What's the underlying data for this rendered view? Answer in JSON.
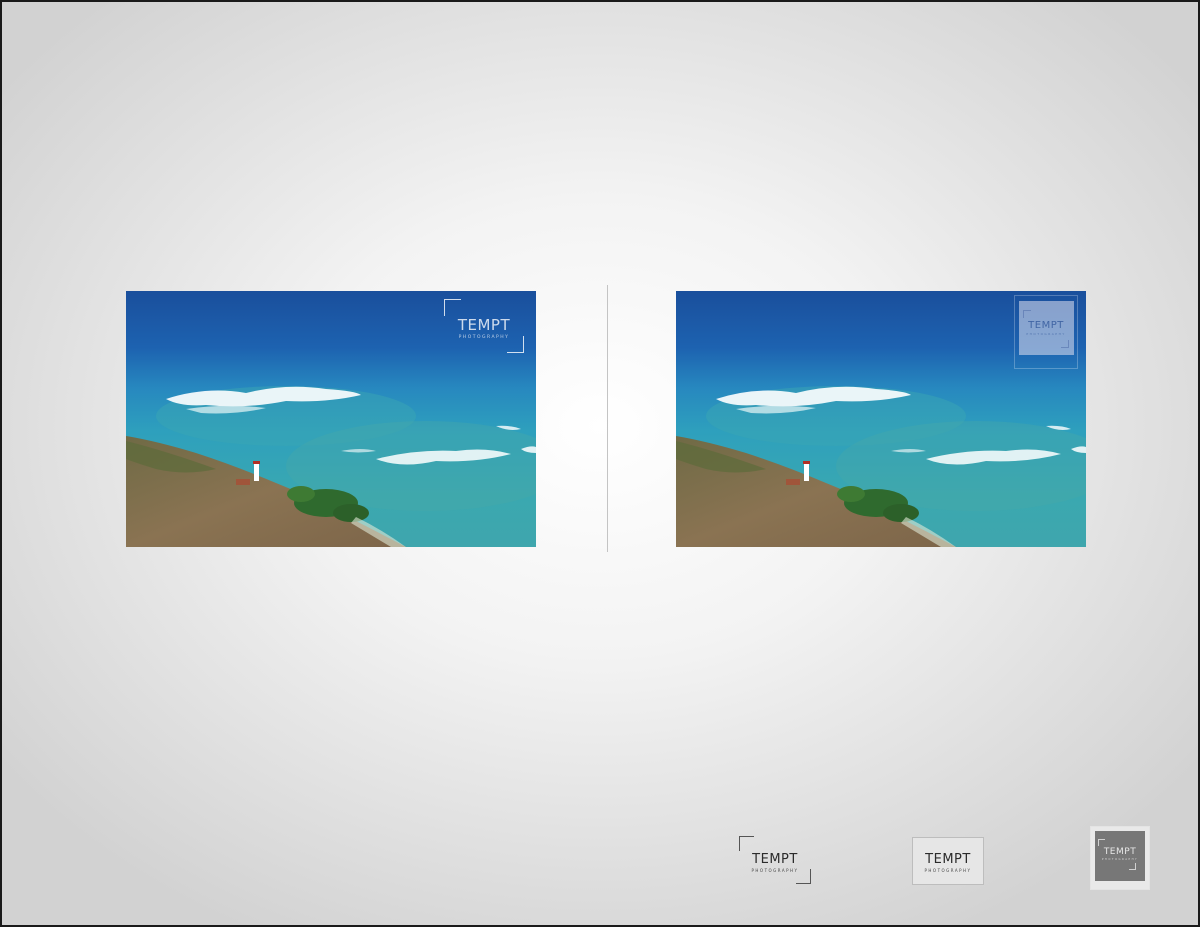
{
  "watermark_left": {
    "title": "TEMPT",
    "subtitle": "PHOTOGRAPHY"
  },
  "watermark_right": {
    "title": "TEMPT",
    "subtitle": "PHOTOGRAPHY"
  },
  "logos": [
    {
      "title": "TEMPT",
      "subtitle": "PHOTOGRAPHY",
      "style": "corner-brackets"
    },
    {
      "title": "TEMPT",
      "subtitle": "PHOTOGRAPHY",
      "style": "bordered-box"
    },
    {
      "title": "TEMPT",
      "subtitle": "PHOTOGRAPHY",
      "style": "dark-square"
    }
  ],
  "colors": {
    "background": "#f2f2f2",
    "deep_ocean": "#1d5aa5",
    "reef_turquoise": "#2fa3b8",
    "coast_brown": "#7d6a4c",
    "logo_dark": "#777777"
  }
}
